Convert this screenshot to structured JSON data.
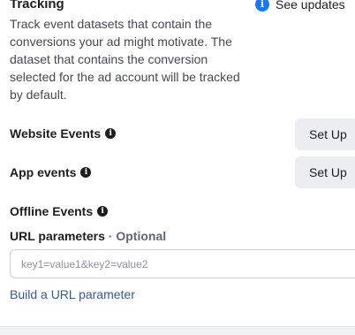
{
  "section": {
    "title": "Tracking",
    "see_updates_label": "See updates",
    "description": "Track event datasets that contain the conversions your ad might motivate. The dataset that contains the conversion selected for the ad account will be tracked by default."
  },
  "events": {
    "website_label": "Website Events",
    "app_label": "App events",
    "offline_label": "Offline Events",
    "setup_label": "Set Up"
  },
  "url_params": {
    "label": "URL parameters",
    "optional": "· Optional",
    "placeholder": "key1=value1&key2=value2",
    "value": "",
    "build_link": "Build a URL parameter"
  },
  "colors": {
    "accent": "#1877f2",
    "link": "#385898",
    "button_bg": "#ebedf0"
  },
  "icons": {
    "see_updates": "info-icon",
    "row_info": "info-icon"
  }
}
